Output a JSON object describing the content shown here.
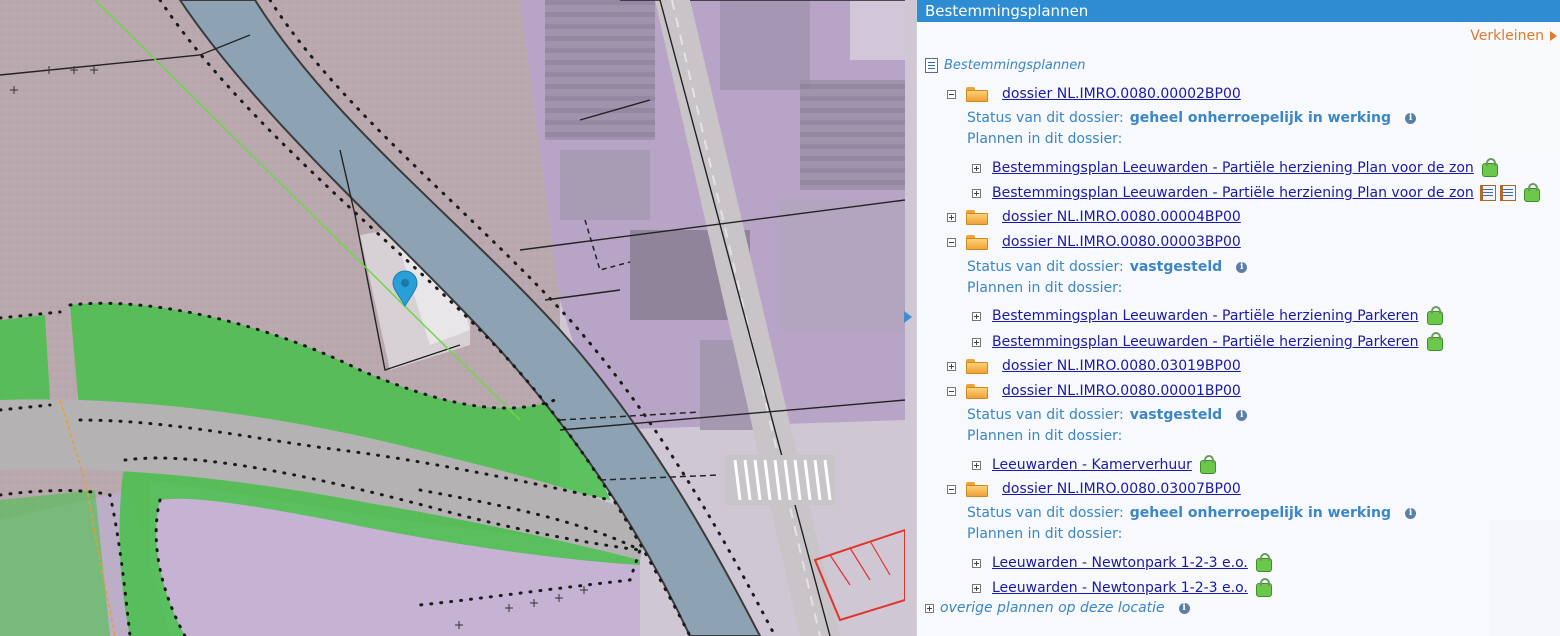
{
  "panel": {
    "title": "Bestemmingsplannen",
    "collapse_label": "Verkleinen",
    "root_label": "Bestemmingsplannen",
    "status_prefix": "Status van dit dossier:",
    "plans_label": "Plannen in dit dossier:",
    "dossiers": [
      {
        "id": "dossier NL.IMRO.0080.00002BP00",
        "expanded": true,
        "status": "geheel onherroepelijk in werking",
        "plans": [
          {
            "label": "Bestemmingsplan Leeuwarden - Partiële herziening Plan voor de zon",
            "icons": [
              "lock-icon"
            ]
          },
          {
            "label": "Bestemmingsplan Leeuwarden - Partiële herziening Plan voor de zon",
            "icons": [
              "document-book-icon",
              "document-book-icon",
              "lock-icon"
            ]
          }
        ]
      },
      {
        "id": "dossier NL.IMRO.0080.00004BP00",
        "expanded": false
      },
      {
        "id": "dossier NL.IMRO.0080.00003BP00",
        "expanded": true,
        "status": "vastgesteld",
        "plans": [
          {
            "label": "Bestemmingsplan Leeuwarden - Partiële herziening Parkeren",
            "icons": [
              "lock-icon"
            ]
          },
          {
            "label": "Bestemmingsplan Leeuwarden - Partiële herziening Parkeren",
            "icons": [
              "lock-icon"
            ]
          }
        ]
      },
      {
        "id": "dossier NL.IMRO.0080.03019BP00",
        "expanded": false
      },
      {
        "id": "dossier NL.IMRO.0080.00001BP00",
        "expanded": true,
        "status": "vastgesteld",
        "plans": [
          {
            "label": "Leeuwarden - Kamerverhuur",
            "icons": [
              "lock-icon"
            ]
          }
        ]
      },
      {
        "id": "dossier NL.IMRO.0080.03007BP00",
        "expanded": true,
        "status": "geheel onherroepelijk in werking",
        "plans": [
          {
            "label": "Leeuwarden - Newtonpark 1-2-3 e.o.",
            "icons": [
              "lock-icon"
            ]
          },
          {
            "label": "Leeuwarden - Newtonpark 1-2-3 e.o.",
            "icons": [
              "lock-icon"
            ]
          }
        ]
      }
    ],
    "other_plans_label": "overige plannen op deze locatie"
  },
  "colors": {
    "header_bg": "#2e8cd3",
    "accent_orange": "#e07a2e",
    "link_blue": "#1a1aa8",
    "status_blue": "#3a86c8",
    "canal": "#8ea3b2",
    "green_zone": "#3fbf3c",
    "lilac_zone": "#c8b6d8"
  },
  "map": {
    "marker_icon": "location-pin-icon"
  }
}
